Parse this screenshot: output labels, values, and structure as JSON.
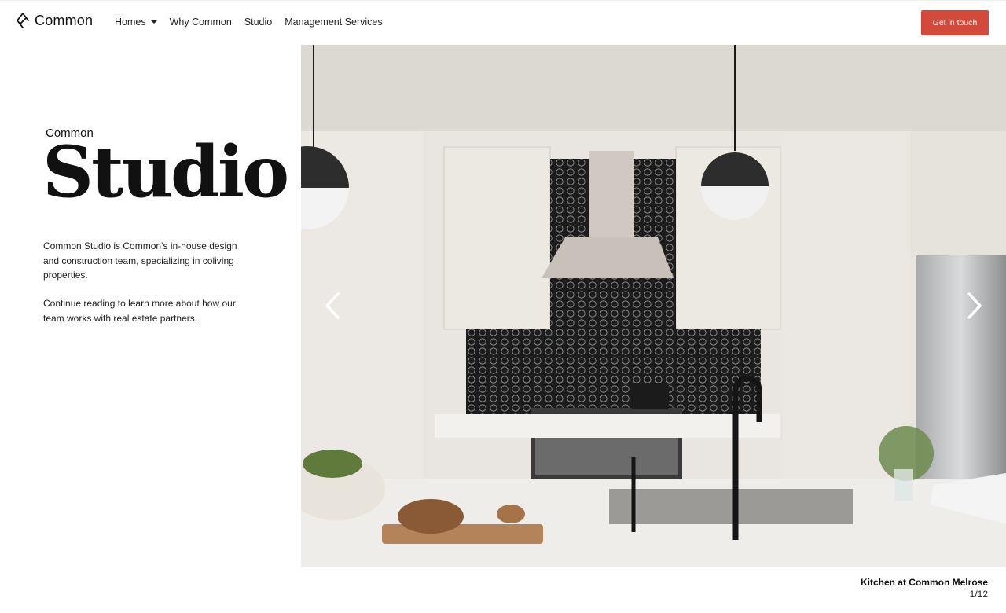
{
  "header": {
    "brand": "Common",
    "nav": [
      {
        "label": "Homes",
        "has_dropdown": true
      },
      {
        "label": "Why Common",
        "has_dropdown": false
      },
      {
        "label": "Studio",
        "has_dropdown": false
      },
      {
        "label": "Management Services",
        "has_dropdown": false
      }
    ],
    "cta_label": "Get in touch"
  },
  "hero": {
    "eyebrow": "Common",
    "title": "Studio",
    "paragraph_1": "Common Studio is Common’s in-house design and construction team, specializing in coliving properties.",
    "paragraph_2": "Continue reading to learn more about how our team works with real estate partners."
  },
  "gallery": {
    "caption": "Kitchen at Common Melrose",
    "counter": "1/12",
    "prev_icon": "chevron-left-icon",
    "next_icon": "chevron-right-icon"
  },
  "colors": {
    "accent": "#d44a3a",
    "text": "#222222"
  }
}
